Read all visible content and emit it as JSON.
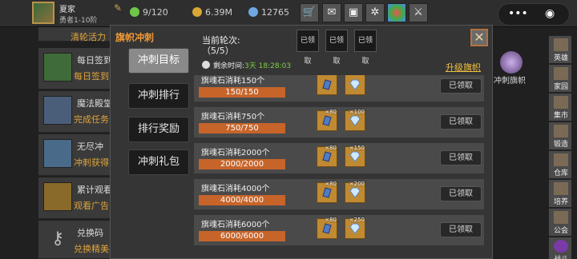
{
  "player": {
    "name": "夏家",
    "level": "勇者1-10阶"
  },
  "resources": [
    {
      "icon": "lightning-icon",
      "value": "9/120",
      "color": "#6ec84a"
    },
    {
      "icon": "coin-icon",
      "value": "6.39M",
      "color": "#d9a534"
    },
    {
      "icon": "gem-icon",
      "value": "12765",
      "color": "#6fa8e0"
    }
  ],
  "toolbar": [
    "shop-cart-icon",
    "mail-icon",
    "gamepad-icon",
    "gear-icon",
    "swirl-icon",
    "sword-icon"
  ],
  "capsule": {
    "menu": "•••",
    "close": "◉"
  },
  "background_list": {
    "top_title": "清轮活力",
    "rows": [
      {
        "title": "每日签到",
        "sub": "每日签到"
      },
      {
        "title": "魔法殿堂",
        "sub": "完成任务"
      },
      {
        "title": "无尽冲",
        "sub": "冲刺获得"
      },
      {
        "title": "累计观看",
        "sub": "观看广告"
      },
      {
        "title": "兑换码",
        "sub": "兑换精美礼品"
      }
    ]
  },
  "right_badge": {
    "label": "冲刺旗帜"
  },
  "side_menu": [
    "英雄",
    "家园",
    "集市",
    "锻造",
    "仓库",
    "培养",
    "公会",
    "战斗"
  ],
  "modal": {
    "title": "旗帜冲刺",
    "tabs": [
      "冲刺目标",
      "冲刺排行",
      "排行奖励",
      "冲刺礼包"
    ],
    "active_tab": 0,
    "round_label": "当前轮次:",
    "round_value": "（5/5）",
    "round_claimed": [
      "已领取",
      "已领取",
      "已领取"
    ],
    "time_label": "剩余时间:",
    "time_value": "3天 18:28:03",
    "upgrade_link": "升级旗帜",
    "close": "✕",
    "goals": [
      {
        "title": "旗魂石消耗150个",
        "progress": "150/150",
        "fraction": 1.0,
        "rewards": [
          {
            "type": "blue-rune",
            "qty": ""
          },
          {
            "type": "diamond",
            "qty": ""
          }
        ],
        "button": "已领取"
      },
      {
        "title": "旗魂石消耗750个",
        "progress": "750/750",
        "fraction": 1.0,
        "rewards": [
          {
            "type": "blue-rune",
            "qty": "×80"
          },
          {
            "type": "diamond",
            "qty": "×100"
          }
        ],
        "button": "已领取"
      },
      {
        "title": "旗魂石消耗2000个",
        "progress": "2000/2000",
        "fraction": 1.0,
        "rewards": [
          {
            "type": "blue-rune",
            "qty": "×80"
          },
          {
            "type": "diamond",
            "qty": "×150"
          }
        ],
        "button": "已领取"
      },
      {
        "title": "旗魂石消耗4000个",
        "progress": "4000/4000",
        "fraction": 1.0,
        "rewards": [
          {
            "type": "blue-rune",
            "qty": "×80"
          },
          {
            "type": "diamond",
            "qty": "×200"
          }
        ],
        "button": "已领取"
      },
      {
        "title": "旗魂石消耗6000个",
        "progress": "6000/6000",
        "fraction": 1.0,
        "rewards": [
          {
            "type": "blue-rune",
            "qty": "×80"
          },
          {
            "type": "diamond",
            "qty": "×250"
          }
        ],
        "button": "已领取"
      }
    ]
  }
}
